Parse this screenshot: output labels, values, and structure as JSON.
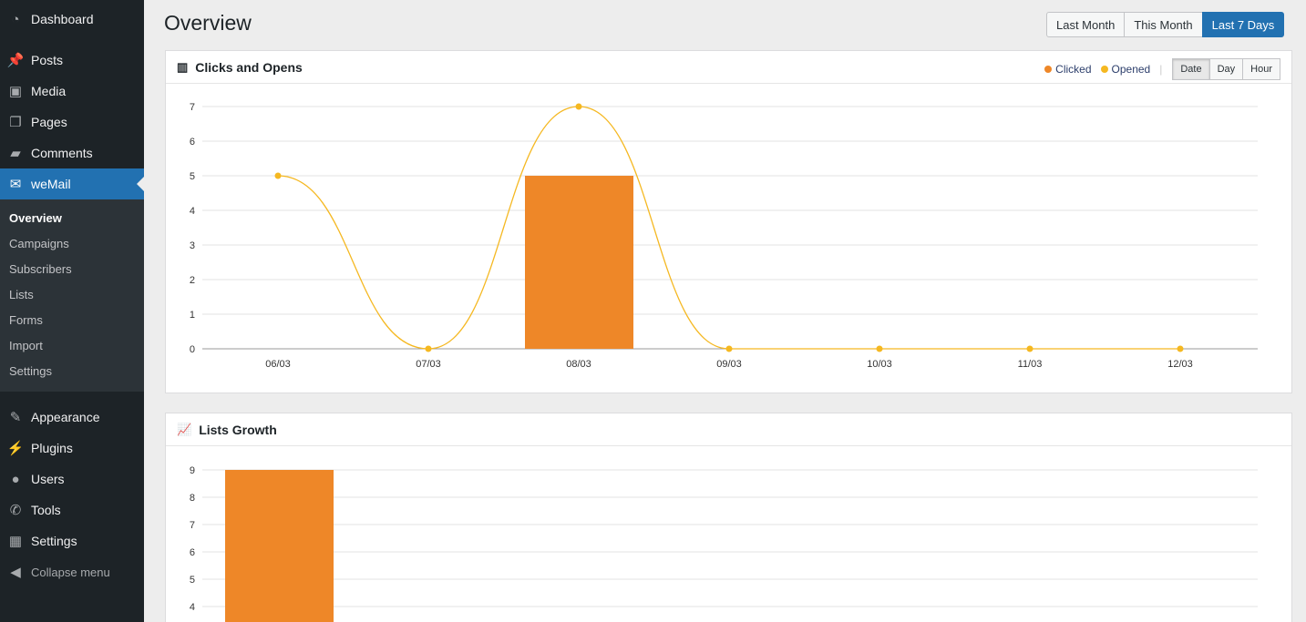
{
  "sidebar": {
    "items": [
      {
        "label": "Dashboard",
        "icon": "dashboard-icon",
        "glyph": "◔"
      },
      {
        "label": "Posts",
        "icon": "pin-icon",
        "glyph": "📌"
      },
      {
        "label": "Media",
        "icon": "media-icon",
        "glyph": "▣"
      },
      {
        "label": "Pages",
        "icon": "pages-icon",
        "glyph": "❐"
      },
      {
        "label": "Comments",
        "icon": "comment-icon",
        "glyph": "▰"
      },
      {
        "label": "weMail",
        "icon": "envelope-icon",
        "glyph": "✉"
      },
      {
        "label": "Appearance",
        "icon": "brush-icon",
        "glyph": "✎"
      },
      {
        "label": "Plugins",
        "icon": "plug-icon",
        "glyph": "⚡"
      },
      {
        "label": "Users",
        "icon": "user-icon",
        "glyph": "●"
      },
      {
        "label": "Tools",
        "icon": "wrench-icon",
        "glyph": "✆"
      },
      {
        "label": "Settings",
        "icon": "settings-icon",
        "glyph": "▦"
      },
      {
        "label": "Collapse menu",
        "icon": "collapse-icon",
        "glyph": "◀"
      }
    ],
    "submenu": [
      "Overview",
      "Campaigns",
      "Subscribers",
      "Lists",
      "Forms",
      "Import",
      "Settings"
    ]
  },
  "page": {
    "title": "Overview",
    "ranges": [
      "Last Month",
      "This Month",
      "Last 7 Days"
    ],
    "active_range": "Last 7 Days"
  },
  "colors": {
    "clicked": "#ee8728",
    "opened": "#f5b821",
    "accent": "#2271b1"
  },
  "chart_data": [
    {
      "type": "bar+line",
      "title": "Clicks and Opens",
      "categories": [
        "06/03",
        "07/03",
        "08/03",
        "09/03",
        "10/03",
        "11/03",
        "12/03"
      ],
      "series": [
        {
          "name": "Clicked",
          "type": "bar",
          "values": [
            0,
            0,
            5,
            0,
            0,
            0,
            0
          ]
        },
        {
          "name": "Opened",
          "type": "line",
          "values": [
            5,
            0,
            7,
            0,
            0,
            0,
            0
          ]
        }
      ],
      "ylim": [
        0,
        7
      ],
      "yticks": [
        0,
        1,
        2,
        3,
        4,
        5,
        6,
        7
      ],
      "grid": true,
      "legend": "top-right",
      "groupings": [
        "Date",
        "Day",
        "Hour"
      ],
      "active_grouping": "Date"
    },
    {
      "type": "bar",
      "title": "Lists Growth",
      "values": [
        9
      ],
      "ylim": [
        0,
        9
      ],
      "yticks": [
        4,
        5,
        6,
        7,
        8,
        9
      ],
      "grid": true
    }
  ]
}
